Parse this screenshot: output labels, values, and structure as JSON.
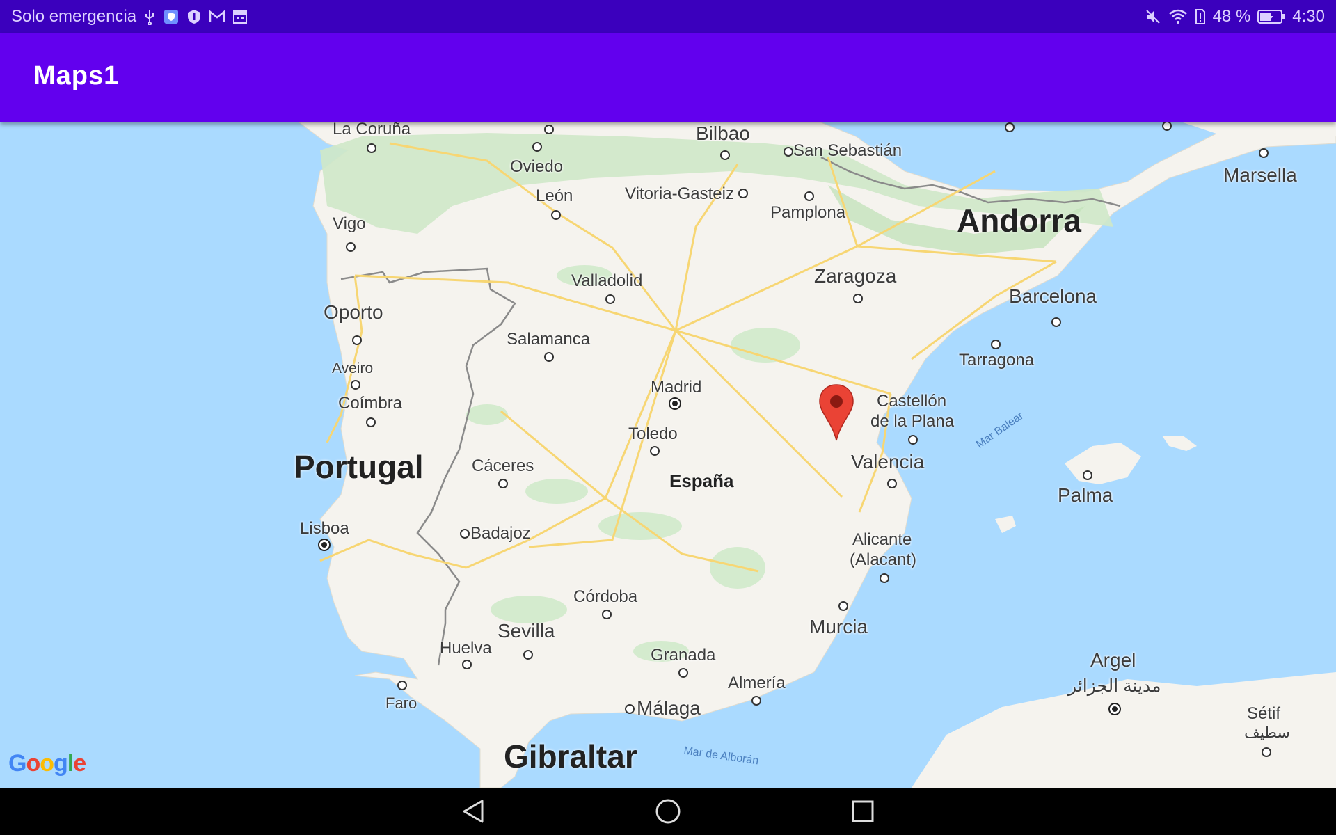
{
  "status_bar": {
    "carrier": "Solo emergencia",
    "battery": "48 %",
    "time": "4:30",
    "icons": [
      "usb-icon",
      "shield-app-icon",
      "security-icon",
      "gmail-icon",
      "calendar-icon",
      "mute-icon",
      "wifi-icon",
      "sim-alert-icon",
      "battery-charging-icon"
    ]
  },
  "app_bar": {
    "title": "Maps1"
  },
  "map": {
    "provider": "Google",
    "countries": {
      "portugal": "Portugal",
      "espana": "España",
      "andorra": "Andorra",
      "gibraltar": "Gibraltar"
    },
    "seas": {
      "balear": "Mar Balear",
      "alboran": "Mar de Alborán"
    },
    "cities": {
      "la_coruna": "La Coruña",
      "oviedo": "Oviedo",
      "bilbao": "Bilbao",
      "san_sebastian": "San Sebastián",
      "marsella": "Marsella",
      "leon": "León",
      "vitoria": "Vitoria-Gasteiz",
      "pamplona": "Pamplona",
      "vigo": "Vigo",
      "valladolid": "Valladolid",
      "zaragoza": "Zaragoza",
      "barcelona": "Barcelona",
      "oporto": "Oporto",
      "salamanca": "Salamanca",
      "tarragona": "Tarragona",
      "aveiro": "Aveiro",
      "madrid": "Madrid",
      "coimbra": "Coímbra",
      "castellon_1": "Castellón",
      "castellon_2": "de la Plana",
      "toledo": "Toledo",
      "caceres": "Cáceres",
      "valencia": "Valencia",
      "palma": "Palma",
      "lisboa": "Lisboa",
      "badajoz": "Badajoz",
      "alicante_1": "Alicante",
      "alicante_2": "(Alacant)",
      "cordoba": "Córdoba",
      "murcia": "Murcia",
      "sevilla": "Sevilla",
      "huelva": "Huelva",
      "granada": "Granada",
      "argel": "Argel",
      "argel_ar": "مدينة الجزائر",
      "almeria": "Almería",
      "faro": "Faro",
      "malaga": "Málaga",
      "setif": "Sétif",
      "setif_ar": "سطيف"
    },
    "marker": {
      "color": "#ea4335"
    }
  },
  "nav_bar": {
    "back": "back-icon",
    "home": "home-icon",
    "recents": "recents-icon"
  }
}
